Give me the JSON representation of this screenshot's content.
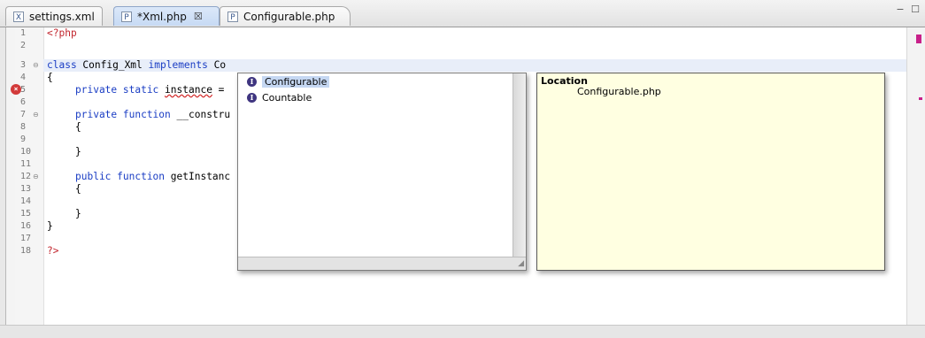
{
  "tabs": [
    {
      "icon": "X",
      "label": "settings.xml"
    },
    {
      "icon": "P",
      "label": "*Xml.php",
      "close": "☒"
    },
    {
      "icon": "P",
      "label": "Configurable.php"
    }
  ],
  "window_controls": "− ☐",
  "line_numbers": [
    "1",
    "2",
    "3",
    "4",
    "5",
    "6",
    "7",
    "8",
    "9",
    "10",
    "11",
    "12",
    "13",
    "14",
    "15",
    "16",
    "17",
    "18"
  ],
  "code": {
    "l1": "<?php",
    "l3_kw1": "class",
    "l3_name": " Config_Xml ",
    "l3_kw2": "implements",
    "l3_rest": " Co",
    "l4": "{",
    "l5_kw": "private static",
    "l5_sp": " ",
    "l5_var": "instance",
    "l5_rest": " =",
    "l7_kw": "private function",
    "l7_rest": " __constru",
    "l8": "{",
    "l10": "}",
    "l12_kw": "public function",
    "l12_rest": " getInstanc",
    "l13": "{",
    "l15": "}",
    "l16": "}",
    "l18": "?>"
  },
  "completion": {
    "items": [
      {
        "icon": "I",
        "label": "Configurable",
        "selected": true
      },
      {
        "icon": "I",
        "label": "Countable",
        "selected": false
      }
    ]
  },
  "info": {
    "title": "Location",
    "value": "Configurable.php"
  },
  "colors": {
    "keyword": "#1a3dc4",
    "php_tag": "#c2262e",
    "error": "#d23a3a",
    "info_bg": "#ffffe1",
    "selection": "#c5d7f2"
  }
}
